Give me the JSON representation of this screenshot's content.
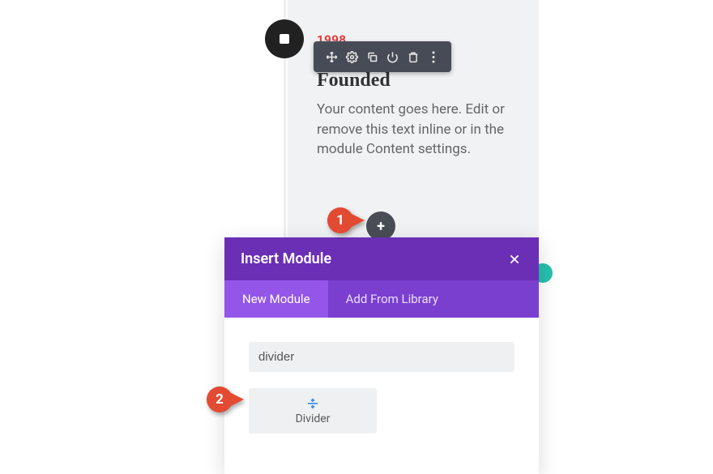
{
  "timeline": {
    "year": "1998",
    "heading": "Founded",
    "body": "Your content goes here. Edit or remove this text inline or in the module Content settings."
  },
  "toolbar": {
    "icons": [
      "move-icon",
      "settings-icon",
      "duplicate-icon",
      "power-icon",
      "delete-icon",
      "more-icon"
    ]
  },
  "add_button": {
    "glyph": "+"
  },
  "modal": {
    "title": "Insert Module",
    "tabs": {
      "new": "New Module",
      "library": "Add From Library"
    },
    "search_value": "divider",
    "module": {
      "label": "Divider"
    }
  },
  "callouts": {
    "one": "1",
    "two": "2"
  }
}
